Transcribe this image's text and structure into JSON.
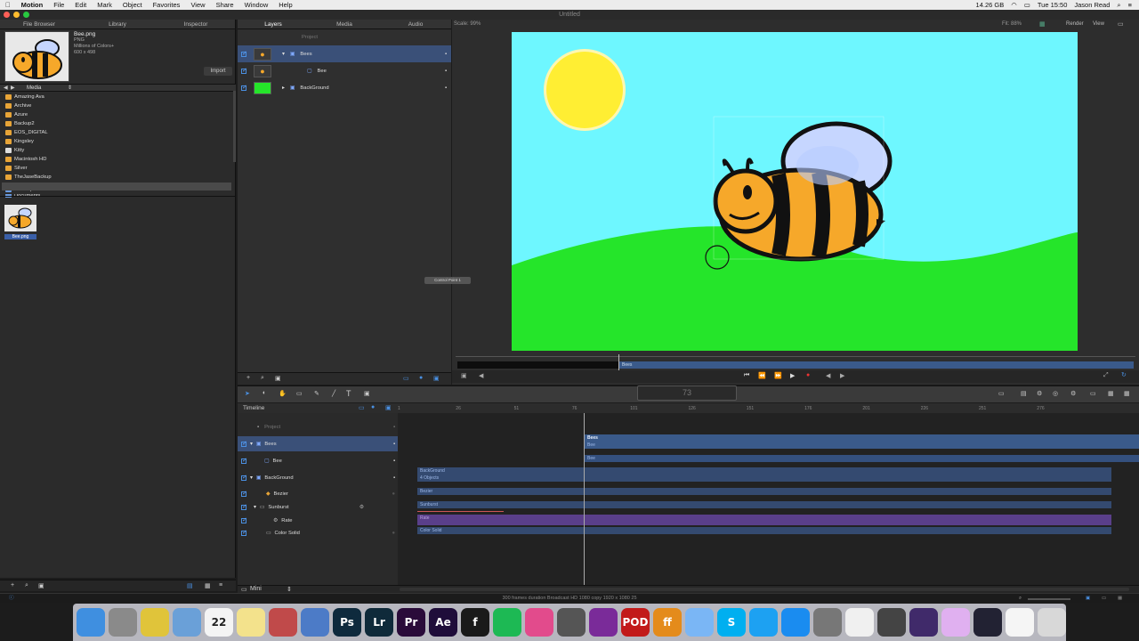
{
  "menubar": {
    "app": "Motion",
    "items": [
      "File",
      "Edit",
      "Mark",
      "Object",
      "Favorites",
      "View",
      "Share",
      "Window",
      "Help"
    ],
    "storage": "14.26 GB",
    "clock": "Tue 15:50",
    "user": "Jason Read"
  },
  "window": {
    "title": "Untitled"
  },
  "left_tabs": [
    "File Browser",
    "Library",
    "Inspector"
  ],
  "file": {
    "name": "Bee.png",
    "type": "PNG",
    "colors": "Millions of Colors+",
    "size": "600 x 498",
    "import": "Import"
  },
  "media_label": "Media",
  "folders": [
    "Amazing Ava",
    "Archive",
    "Azure",
    "Backup2",
    "EOS_DIGITAL",
    "Kingsley",
    "Kitty",
    "Macintosh HD",
    "Silver",
    "TheJaseBackup",
    "Desktop",
    "Documents"
  ],
  "thumb_label": "Bee.png",
  "center_tabs": [
    "Layers",
    "Media",
    "Audio"
  ],
  "layers": {
    "project": "Project",
    "rows": [
      {
        "name": "Bees",
        "selected": true
      },
      {
        "name": "Bee",
        "selected": false
      },
      {
        "name": "BackGround",
        "selected": false
      }
    ]
  },
  "canvas": {
    "scale": "Scale: 99%",
    "fit": "Fit: 88%",
    "render": "Render",
    "view": "View",
    "tooltip": "Control Point 1"
  },
  "mini_timeline": {
    "bar_label": "Bees"
  },
  "timecode": "73",
  "timeline": {
    "title": "Timeline",
    "ruler": [
      "1",
      "26",
      "51",
      "76",
      "101",
      "126",
      "151",
      "176",
      "201",
      "226",
      "251",
      "276"
    ],
    "rows": [
      {
        "name": "Project"
      },
      {
        "name": "Bees"
      },
      {
        "name": "Bee"
      },
      {
        "name": "BackGround"
      },
      {
        "name": "Bezier"
      },
      {
        "name": "Sunburst"
      },
      {
        "name": "Rate"
      },
      {
        "name": "Color Solid"
      }
    ],
    "bars": {
      "bees": "Bees",
      "bees_sub": "Bee",
      "bee": "Bee",
      "background": "BackGround",
      "background_sub": "4 Objects",
      "bezier": "Bezier",
      "sunburst": "Sunburst",
      "rate": "Rate",
      "color_solid": "Color Solid"
    },
    "mini": "Mini"
  },
  "status": "300 frames duration Broadcast HD 1080 copy 1920 x 1080 25",
  "dock": [
    {
      "name": "finder-icon",
      "label": "",
      "color": "#3f8fe0"
    },
    {
      "name": "launchpad-icon",
      "label": "",
      "color": "#8a8a8a"
    },
    {
      "name": "chrome-icon",
      "label": "",
      "color": "#e0c43a"
    },
    {
      "name": "preview-icon",
      "label": "",
      "color": "#6aa0d8"
    },
    {
      "name": "calendar-icon",
      "label": "22",
      "color": "#f4f4f4"
    },
    {
      "name": "notes-icon",
      "label": "",
      "color": "#f3e28c"
    },
    {
      "name": "davinci-icon",
      "label": "",
      "color": "#c04a4a"
    },
    {
      "name": "xcode-icon",
      "label": "",
      "color": "#4c7bc7"
    },
    {
      "name": "photoshop-icon",
      "label": "Ps",
      "color": "#0e2a3d"
    },
    {
      "name": "lightroom-icon",
      "label": "Lr",
      "color": "#0f2a3a"
    },
    {
      "name": "premiere-icon",
      "label": "Pr",
      "color": "#2a0b3a"
    },
    {
      "name": "aftereffects-icon",
      "label": "Ae",
      "color": "#1f0d3a"
    },
    {
      "name": "fontlab-icon",
      "label": "f",
      "color": "#1a1a1a"
    },
    {
      "name": "spotify-icon",
      "label": "",
      "color": "#1db954"
    },
    {
      "name": "itunes-icon",
      "label": "",
      "color": "#e24b8c"
    },
    {
      "name": "iphoto-icon",
      "label": "",
      "color": "#555"
    },
    {
      "name": "motion-icon",
      "label": "",
      "color": "#7a2b99"
    },
    {
      "name": "podcast-icon",
      "label": "POD",
      "color": "#c21a1a"
    },
    {
      "name": "fl-icon",
      "label": "ff",
      "color": "#e48b1b"
    },
    {
      "name": "messages-icon",
      "label": "",
      "color": "#7ab6f5"
    },
    {
      "name": "skype-icon",
      "label": "S",
      "color": "#00aff0"
    },
    {
      "name": "twitter-icon",
      "label": "",
      "color": "#1da1f2"
    },
    {
      "name": "appstore-icon",
      "label": "",
      "color": "#1a8cf0"
    },
    {
      "name": "sysprefs-icon",
      "label": "",
      "color": "#777"
    },
    {
      "name": "photos-icon",
      "label": "",
      "color": "#f0f0f0"
    },
    {
      "name": "finalcut-icon",
      "label": "",
      "color": "#444"
    },
    {
      "name": "imovie-icon",
      "label": "",
      "color": "#402a6a"
    },
    {
      "name": "colorsync-icon",
      "label": "",
      "color": "#e0b0f0"
    },
    {
      "name": "quicktime-icon",
      "label": "",
      "color": "#223"
    },
    {
      "name": "mp4-icon",
      "label": "",
      "color": "#f5f5f5"
    },
    {
      "name": "trash-icon",
      "label": "",
      "color": "#d8d8d8"
    }
  ]
}
